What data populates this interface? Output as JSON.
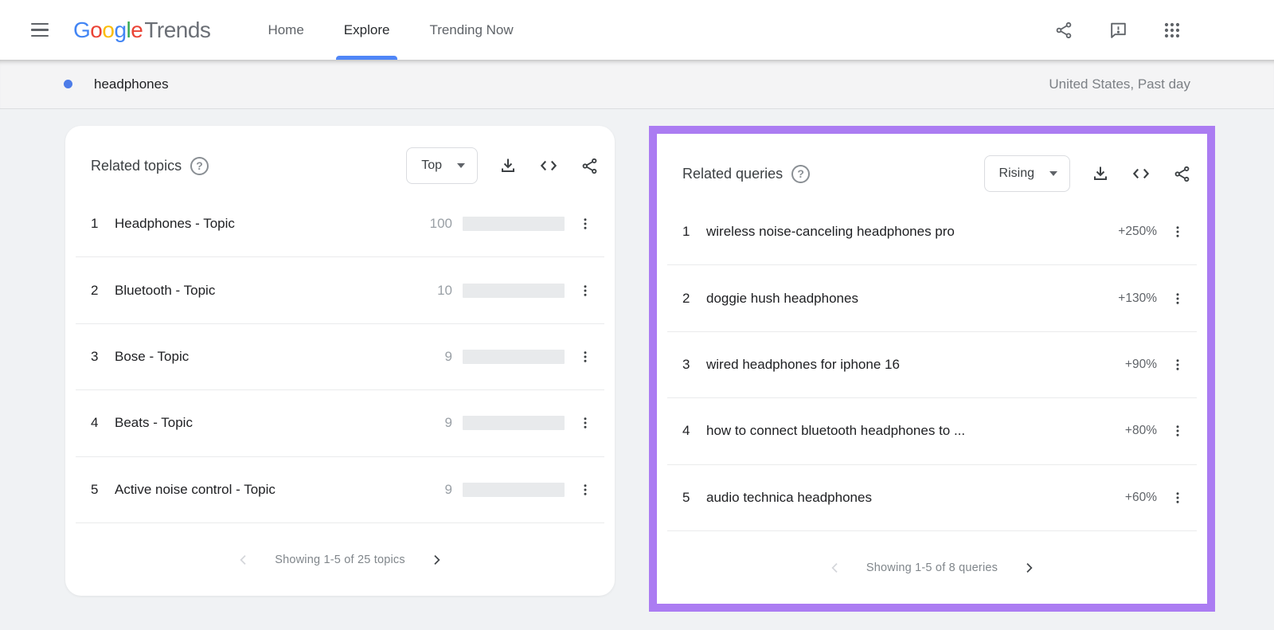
{
  "navbar": {
    "menu_icon": "hamburger-menu",
    "logo": {
      "letters": [
        {
          "ch": "G",
          "color": "#4285F4"
        },
        {
          "ch": "o",
          "color": "#EA4335"
        },
        {
          "ch": "o",
          "color": "#FBBC05"
        },
        {
          "ch": "g",
          "color": "#4285F4"
        },
        {
          "ch": "l",
          "color": "#34A853"
        },
        {
          "ch": "e",
          "color": "#EA4335"
        }
      ],
      "suffix": "Trends"
    },
    "tabs": [
      {
        "label": "Home",
        "active": false
      },
      {
        "label": "Explore",
        "active": true
      },
      {
        "label": "Trending Now",
        "active": false
      }
    ],
    "action_icons": [
      "share",
      "send-feedback",
      "google-apps"
    ]
  },
  "search_bar": {
    "term": "headphones",
    "scope": "United States, Past day"
  },
  "related_topics": {
    "title": "Related topics",
    "sort_selected": "Top",
    "toolbar_icons": [
      "download",
      "embed",
      "share"
    ],
    "rows": [
      {
        "rank": 1,
        "label": "Headphones - Topic",
        "value": 100
      },
      {
        "rank": 2,
        "label": "Bluetooth - Topic",
        "value": 10
      },
      {
        "rank": 3,
        "label": "Bose - Topic",
        "value": 9
      },
      {
        "rank": 4,
        "label": "Beats - Topic",
        "value": 9
      },
      {
        "rank": 5,
        "label": "Active noise control - Topic",
        "value": 9
      }
    ],
    "footer": "Showing 1-5 of 25 topics"
  },
  "related_queries": {
    "title": "Related queries",
    "sort_selected": "Rising",
    "toolbar_icons": [
      "download",
      "embed",
      "share"
    ],
    "rows": [
      {
        "rank": 1,
        "label": "wireless noise-canceling headphones pro",
        "value": "+250%"
      },
      {
        "rank": 2,
        "label": "doggie hush headphones",
        "value": "+130%"
      },
      {
        "rank": 3,
        "label": "wired headphones for iphone 16",
        "value": "+90%"
      },
      {
        "rank": 4,
        "label": "how to connect bluetooth headphones to ...",
        "value": "+80%"
      },
      {
        "rank": 5,
        "label": "audio technica headphones",
        "value": "+60%"
      }
    ],
    "footer": "Showing 1-5 of 8 queries"
  },
  "colors": {
    "accent_blue": "#4d7ce8",
    "tab_underline_blue": "#4f86f7",
    "highlight_purple": "#ab7cf2",
    "bar_track_gray": "#e8eaec"
  }
}
